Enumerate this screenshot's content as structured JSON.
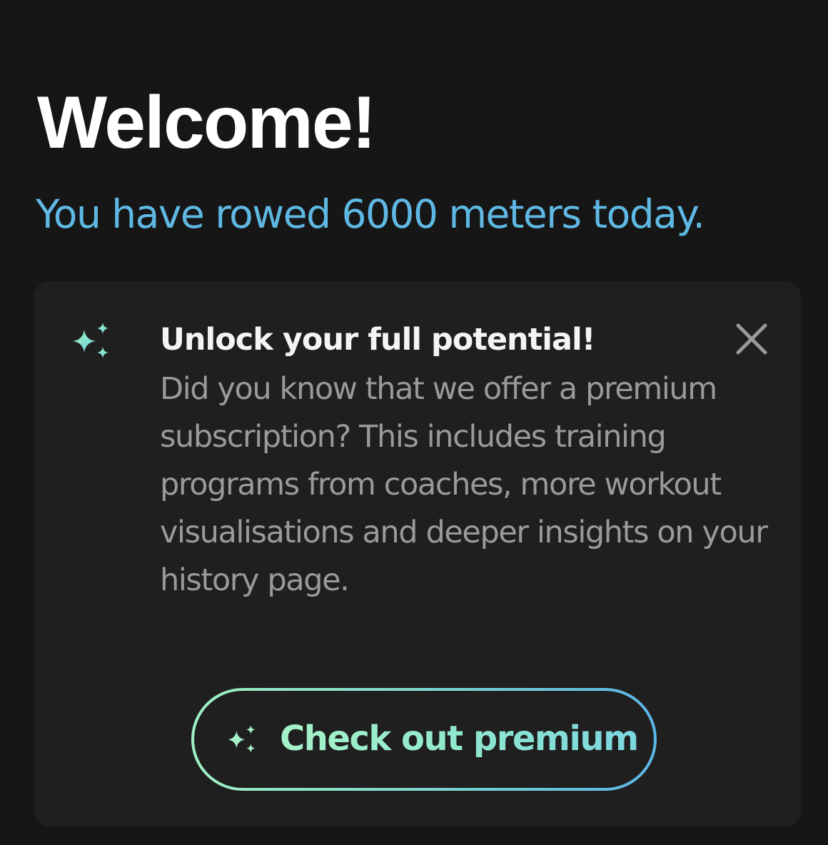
{
  "header": {
    "title": "Welcome!",
    "subtitle": "You have rowed 6000 meters today."
  },
  "promo_card": {
    "icon": "sparkles-icon",
    "heading": "Unlock your full potential!",
    "body": "Did you know that we offer a premium subscription? This includes training programs from coaches, more workout visualisations and deeper insights on your history page.",
    "close_icon": "close-icon",
    "button": {
      "icon": "sparkles-icon",
      "label": "Check out premium"
    }
  },
  "colors": {
    "background": "#161616",
    "card": "#1f1f1f",
    "subtitle_blue": "#5fb8e3",
    "gradient_start": "#9ff0c2",
    "gradient_end": "#5bb6e8"
  }
}
